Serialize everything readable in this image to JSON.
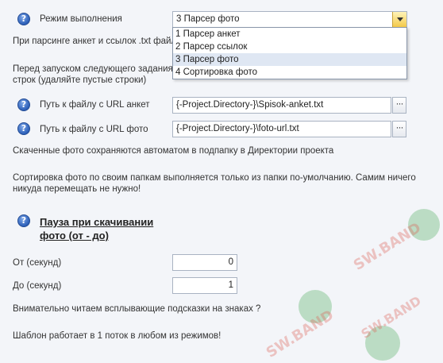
{
  "mode": {
    "label": "Режим выполнения",
    "selected": "3 Парсер фото",
    "options": [
      "1 Парсер анкет",
      "2 Парсер ссылок",
      "3 Парсер фото",
      "4 Сортировка фото"
    ]
  },
  "notes": {
    "parsing": "При парсинге анкет и ссылок .txt файл",
    "before_run_1": "Перед запуском следующего задания",
    "before_run_2": "строк (удаляйте пустые строки)",
    "saved_photos": "Скаченные фото сохраняются автоматом в подпапку в Директории проекта",
    "sort_1": "Сортировка фото по своим папкам выполняется только из папки по-умолчанию. Самим ничего",
    "sort_2": "никуда перемещать не нужно!",
    "tooltips": "Внимательно читаем всплывающие подсказки на знаках ?",
    "threads": "Шаблон работает в 1 поток в любом из режимов!"
  },
  "paths": {
    "ankets_label": "Путь к файлу с URL анкет",
    "ankets_value": "{-Project.Directory-}\\Spisok-anket.txt",
    "photo_label": "Путь к файлу с URL фото",
    "photo_value": "{-Project.Directory-}\\foto-url.txt",
    "browse": "···"
  },
  "pause": {
    "title_1": "Пауза при скачивании",
    "title_2": "фото (от - до)",
    "from_label": "От (секунд)",
    "from_value": "0",
    "to_label": "До (секунд)",
    "to_value": "1"
  },
  "icons": {
    "help": "?",
    "help_icon": "question-circle-icon"
  },
  "watermark": {
    "text": "SW.BAND"
  }
}
